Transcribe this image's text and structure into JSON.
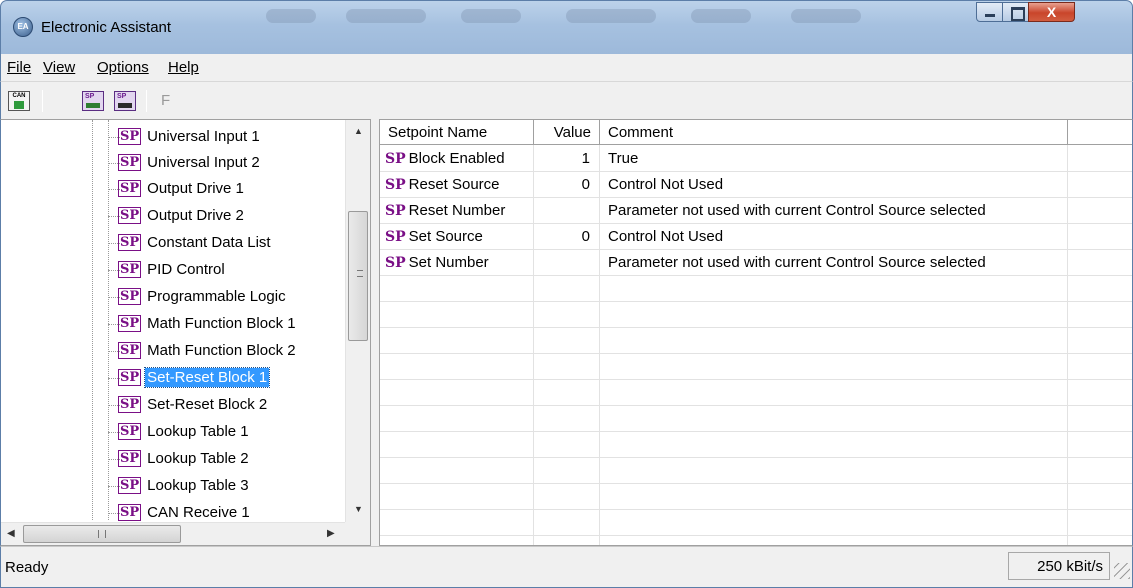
{
  "window": {
    "title": "Electronic Assistant",
    "icon_text": "EA",
    "close_glyph": "X"
  },
  "menu": {
    "file": "File",
    "view": "View",
    "options": "Options",
    "help": "Help"
  },
  "toolbar": {
    "buttons": [
      {
        "name": "can-connect-icon",
        "text": "CAN"
      },
      {
        "name": "sp-open-icon",
        "text": "SP"
      },
      {
        "name": "sp-save-icon",
        "text": "SP"
      }
    ],
    "f_label": "F"
  },
  "tree": {
    "items": [
      {
        "badge": "SP",
        "label": "Universal Input 1"
      },
      {
        "badge": "SP",
        "label": "Universal Input 2"
      },
      {
        "badge": "SP",
        "label": "Output Drive 1"
      },
      {
        "badge": "SP",
        "label": "Output Drive 2"
      },
      {
        "badge": "SP",
        "label": "Constant Data List"
      },
      {
        "badge": "SP",
        "label": "PID Control"
      },
      {
        "badge": "SP",
        "label": "Programmable Logic"
      },
      {
        "badge": "SP",
        "label": "Math Function Block 1"
      },
      {
        "badge": "SP",
        "label": "Math Function Block 2"
      },
      {
        "badge": "SP",
        "label": "Set-Reset Block 1",
        "selected": true
      },
      {
        "badge": "SP",
        "label": "Set-Reset Block 2"
      },
      {
        "badge": "SP",
        "label": "Lookup Table 1"
      },
      {
        "badge": "SP",
        "label": "Lookup Table 2"
      },
      {
        "badge": "SP",
        "label": "Lookup Table 3"
      },
      {
        "badge": "SP",
        "label": "CAN Receive 1"
      }
    ],
    "scroll_up": "▲",
    "scroll_down": "▼",
    "scroll_left": "◀",
    "scroll_right": "▶"
  },
  "grid": {
    "columns": [
      "Setpoint Name",
      "Value",
      "Comment"
    ],
    "rows": [
      {
        "prefix": "SP",
        "name": "Block Enabled",
        "value": "1",
        "comment": "True"
      },
      {
        "prefix": "SP",
        "name": "Reset Source",
        "value": "0",
        "comment": "Control Not Used"
      },
      {
        "prefix": "SP",
        "name": "Reset Number",
        "value": "",
        "comment": "Parameter not used with current Control Source selected"
      },
      {
        "prefix": "SP",
        "name": "Set Source",
        "value": "0",
        "comment": "Control Not Used"
      },
      {
        "prefix": "SP",
        "name": "Set Number",
        "value": "",
        "comment": "Parameter not used with current Control Source selected"
      }
    ]
  },
  "status": {
    "text": "Ready",
    "baud_rate": "250 kBit/s"
  },
  "colors": {
    "sp_purple": "#7a0f86",
    "selection_blue": "#3399ff",
    "titlebar_blue": "#a6c1e0"
  }
}
